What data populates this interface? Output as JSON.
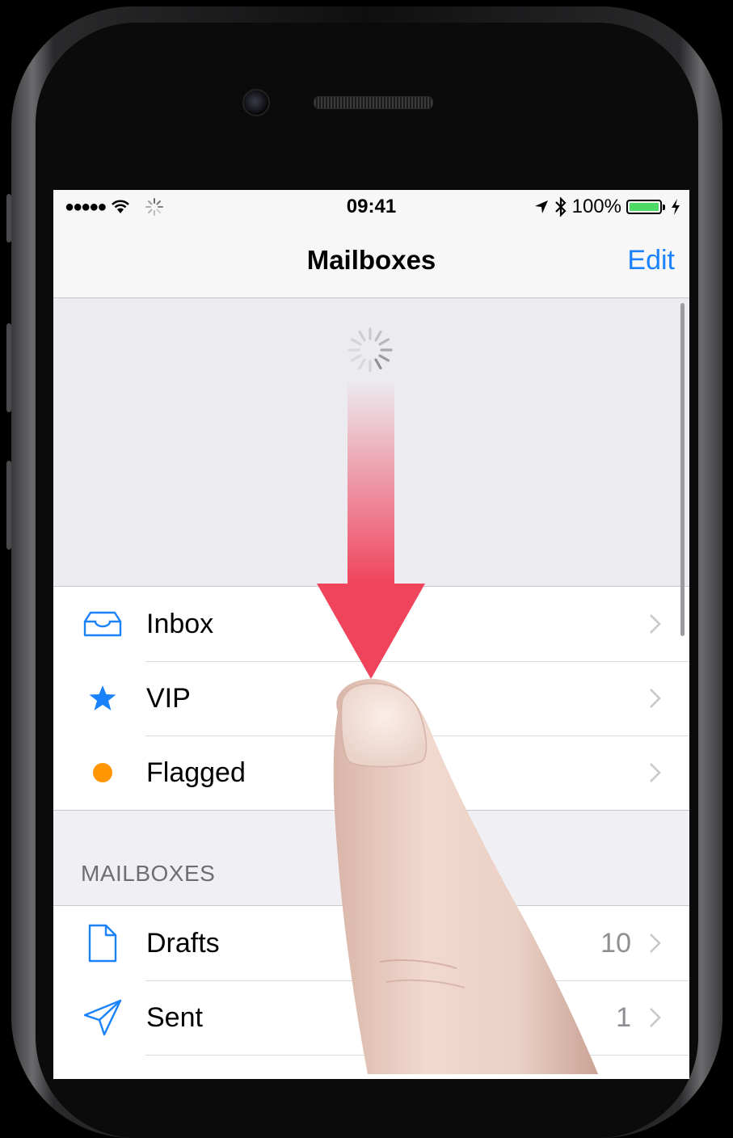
{
  "status_bar": {
    "signal": "●●●●●",
    "time": "09:41",
    "battery_percent": "100%"
  },
  "nav": {
    "title": "Mailboxes",
    "edit_label": "Edit"
  },
  "favorites": [
    {
      "label": "Inbox",
      "icon": "inbox-tray-icon"
    },
    {
      "label": "VIP",
      "icon": "star-icon"
    },
    {
      "label": "Flagged",
      "icon": "orange-dot-icon"
    }
  ],
  "mailboxes_section": {
    "header": "MAILBOXES",
    "items": [
      {
        "label": "Drafts",
        "count": "10",
        "icon": "document-icon"
      },
      {
        "label": "Sent",
        "count": "1",
        "icon": "paper-plane-icon"
      }
    ]
  },
  "colors": {
    "accent": "#1a82fb",
    "flag": "#ff9500",
    "battery": "#4cd964",
    "arrow": "#f0435c"
  },
  "gesture": {
    "type": "pull-to-refresh",
    "icon": "down-arrow-icon"
  }
}
